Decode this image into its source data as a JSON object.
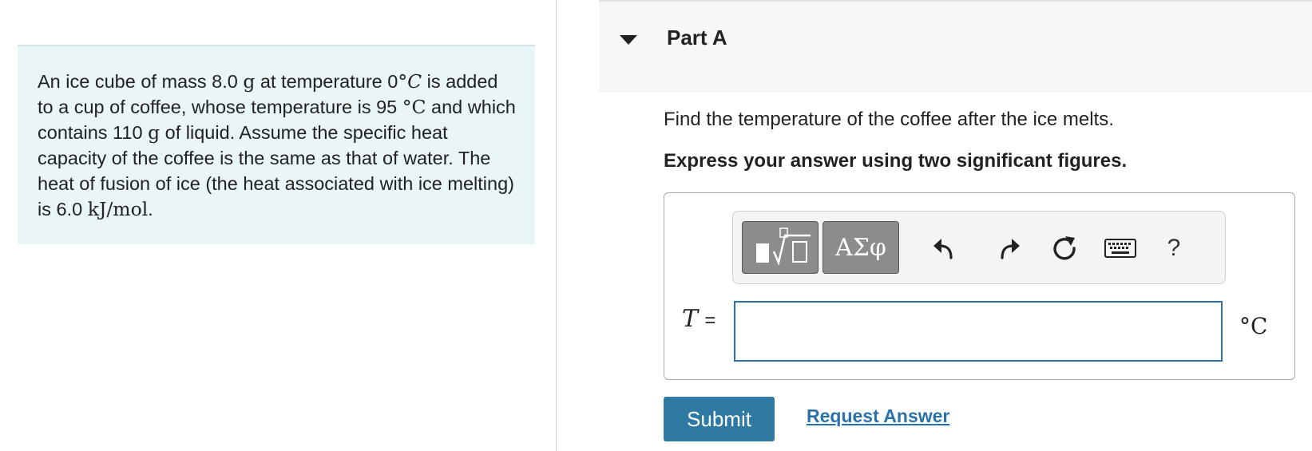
{
  "problem": {
    "text_1": "An ice cube of mass 8.0 ",
    "mass_unit": "g",
    "text_2": " at temperature 0",
    "degree": "°",
    "temp_unit_italic": "C",
    "text_3": " is added to a cup of coffee, whose temperature is 95 ",
    "temp_unit": "°C",
    "text_4": " and which contains 110 ",
    "text_5": " of liquid. Assume the specific heat capacity of the coffee is the same as that of water. The heat of fusion of ice (the heat associated with ice melting) is 6.0 ",
    "heat_unit": "kJ/mol",
    "text_6": "."
  },
  "part": {
    "title": "Part A",
    "question": "Find the temperature of the coffee after the ice melts.",
    "instruction": "Express your answer using two significant figures."
  },
  "toolbar": {
    "symbols_label": "ΑΣφ",
    "help_label": "?",
    "icons": [
      "templates-icon",
      "greek-symbols",
      "undo-icon",
      "redo-icon",
      "reset-icon",
      "keyboard-icon",
      "help-icon"
    ]
  },
  "answer": {
    "variable": "T",
    "equals": "=",
    "value": "",
    "unit": "°C"
  },
  "actions": {
    "submit_label": "Submit",
    "request_label": "Request Answer"
  },
  "colors": {
    "problem_bg": "#e9f5f7",
    "submit_bg": "#2f7aa3",
    "link": "#2a72a8",
    "input_border": "#2f6f9f",
    "toolbar_button": "#8c8c8c"
  }
}
